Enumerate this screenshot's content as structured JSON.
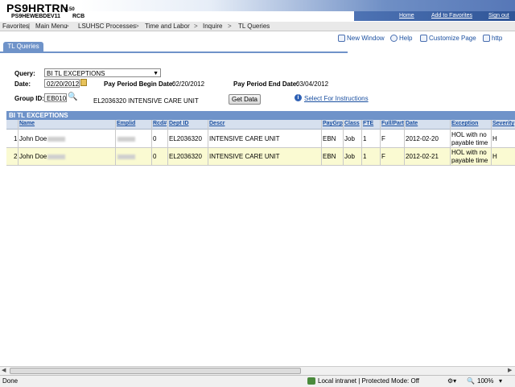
{
  "banner": {
    "title": "PS9HRTRN",
    "version": "8.50",
    "db": "PS9HEWEBDEV11",
    "db_suffix": "RCB",
    "links": [
      "Home",
      "Add to Favorites",
      "Sign out"
    ]
  },
  "breadcrumb": [
    "Favorites",
    "Main Menu",
    "LSUHSC Processes",
    "Time and Labor",
    "Inquire",
    "TL Queries"
  ],
  "toolbar": {
    "new_window": "New Window",
    "help": "Help",
    "customize": "Customize Page",
    "http": "http"
  },
  "tab": {
    "label": "TL Queries"
  },
  "form": {
    "query_label": "Query:",
    "query_value": "BI TL EXCEPTIONS",
    "date_label": "Date:",
    "date_value": "02/20/2012",
    "pp_begin_label": "Pay Period Begin Date:",
    "pp_begin_value": "02/20/2012",
    "pp_end_label": "Pay Period End Date:",
    "pp_end_value": "03/04/2012",
    "group_label": "Group ID:",
    "group_value": "EB010",
    "group_descr": "EL2036320 INTENSIVE CARE UNIT",
    "get_data": "Get Data",
    "instructions": "Select For Instructions"
  },
  "grid": {
    "title": "BI TL EXCEPTIONS",
    "headers": [
      "Name",
      "Emplid",
      "Rcd#",
      "Dept ID",
      "Descr",
      "PayGrp",
      "Class",
      "FTE",
      "Full/Part",
      "Date",
      "Exception",
      "Severity"
    ],
    "rows": [
      {
        "num": "1",
        "name": "John Doe",
        "emplid": "",
        "rcd": "0",
        "dept": "EL2036320",
        "descr": "INTENSIVE CARE UNIT",
        "paygrp": "EBN",
        "class": "Job",
        "fte": "1",
        "fullpart": "F",
        "date": "2012-02-20",
        "exc1": "HOL with no",
        "exc2": "payable time",
        "severity": "H"
      },
      {
        "num": "2",
        "name": "John Doe",
        "emplid": "",
        "rcd": "0",
        "dept": "EL2036320",
        "descr": "INTENSIVE CARE UNIT",
        "paygrp": "EBN",
        "class": "Job",
        "fte": "1",
        "fullpart": "F",
        "date": "2012-02-21",
        "exc1": "HOL with no",
        "exc2": "payable time",
        "severity": "H"
      }
    ]
  },
  "statusbar": {
    "left": "Done",
    "zone": "Local intranet | Protected Mode: Off",
    "zoom": "100%"
  },
  "colors": {
    "accent": "#6f93c9",
    "row_highlight": "#fafad2",
    "link": "#1a4fa0"
  }
}
